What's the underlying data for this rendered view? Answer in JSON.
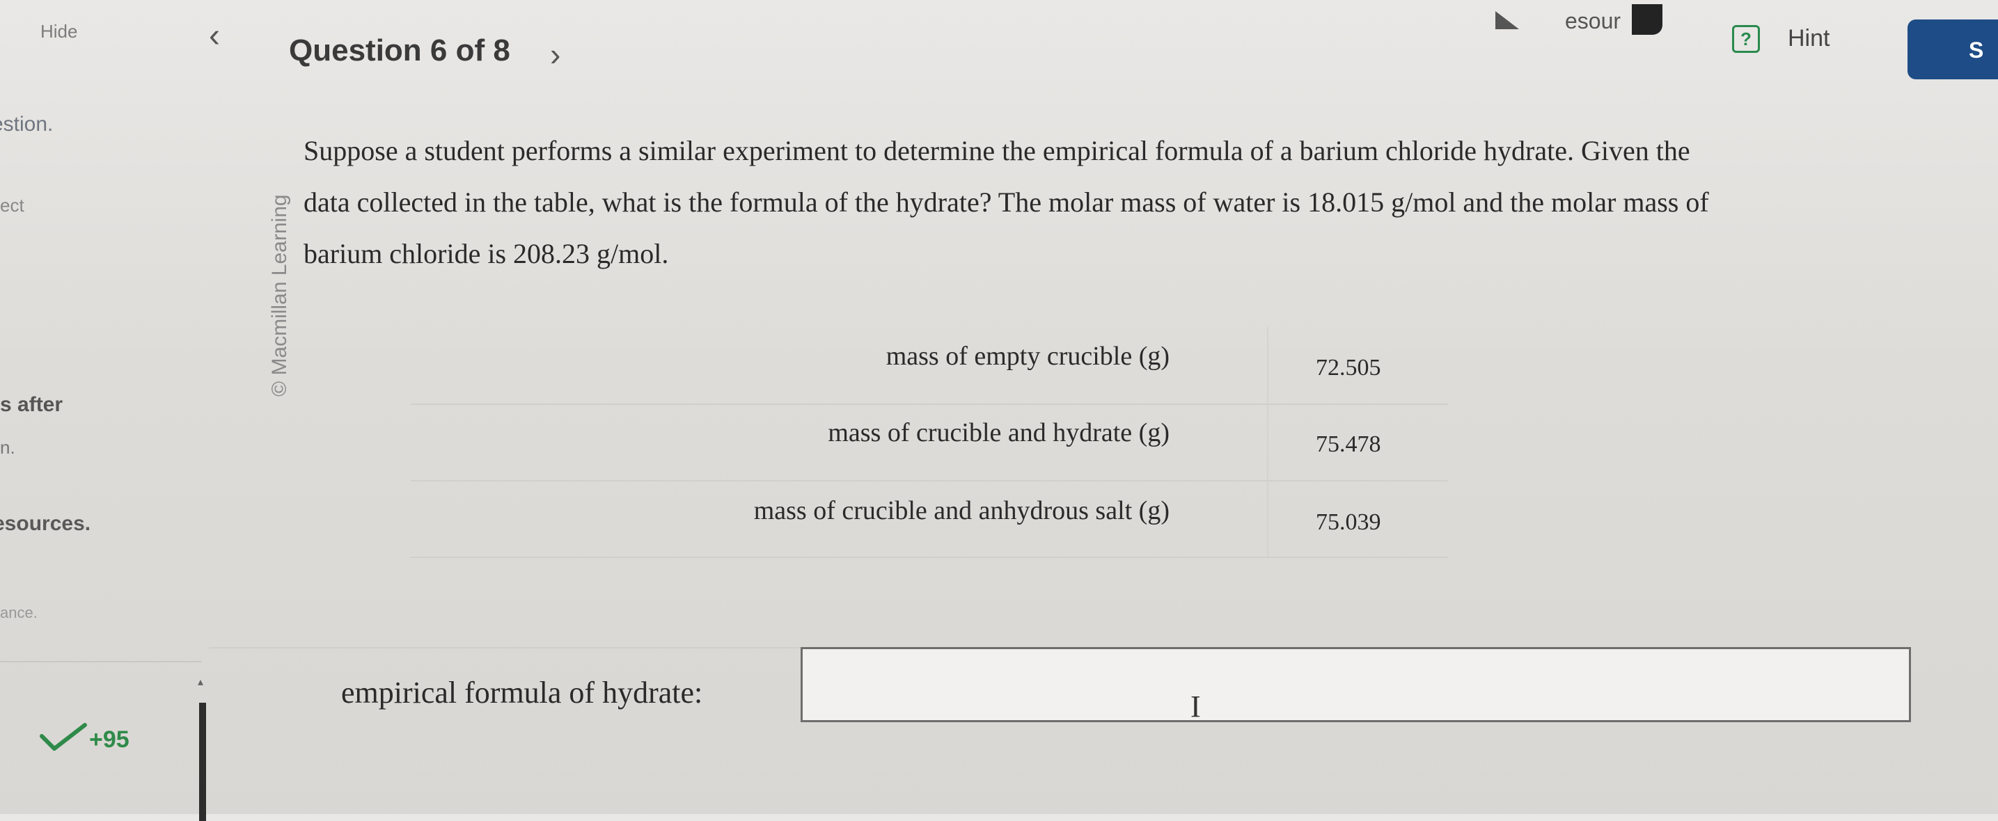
{
  "topbar": {
    "hide_label": "Hide",
    "question_nav": "Question 6 of 8",
    "prev_icon": "chevron-left-icon",
    "next_icon": "chevron-right-icon",
    "resources_label": "esour",
    "hint_icon_glyph": "?",
    "hint_label": "Hint",
    "submit_label": "S",
    "submit_color": "#1e4c87"
  },
  "sidebar": {
    "frag1": "estion.",
    "frag2": "ect",
    "frag3": "s after",
    "frag4": "n.",
    "frag5": "esources.",
    "frag6": "ance.",
    "score": "+95"
  },
  "copyright": "© Macmillan Learning",
  "question": {
    "line1": "Suppose a student performs a similar experiment to determine the empirical formula of a barium chloride hydrate. Given the",
    "line2": "data collected in the table, what is the formula of the hydrate? The molar mass of water is 18.015 g/mol and the molar mass of",
    "line3": "barium chloride is 208.23 g/mol."
  },
  "table": {
    "rows": [
      {
        "label": "mass of empty crucible (g)",
        "value": "72.505"
      },
      {
        "label": "mass of crucible and hydrate (g)",
        "value": "75.478"
      },
      {
        "label": "mass of crucible and anhydrous salt (g)",
        "value": "75.039"
      }
    ]
  },
  "answer": {
    "label": "empirical formula of hydrate:",
    "value": ""
  }
}
